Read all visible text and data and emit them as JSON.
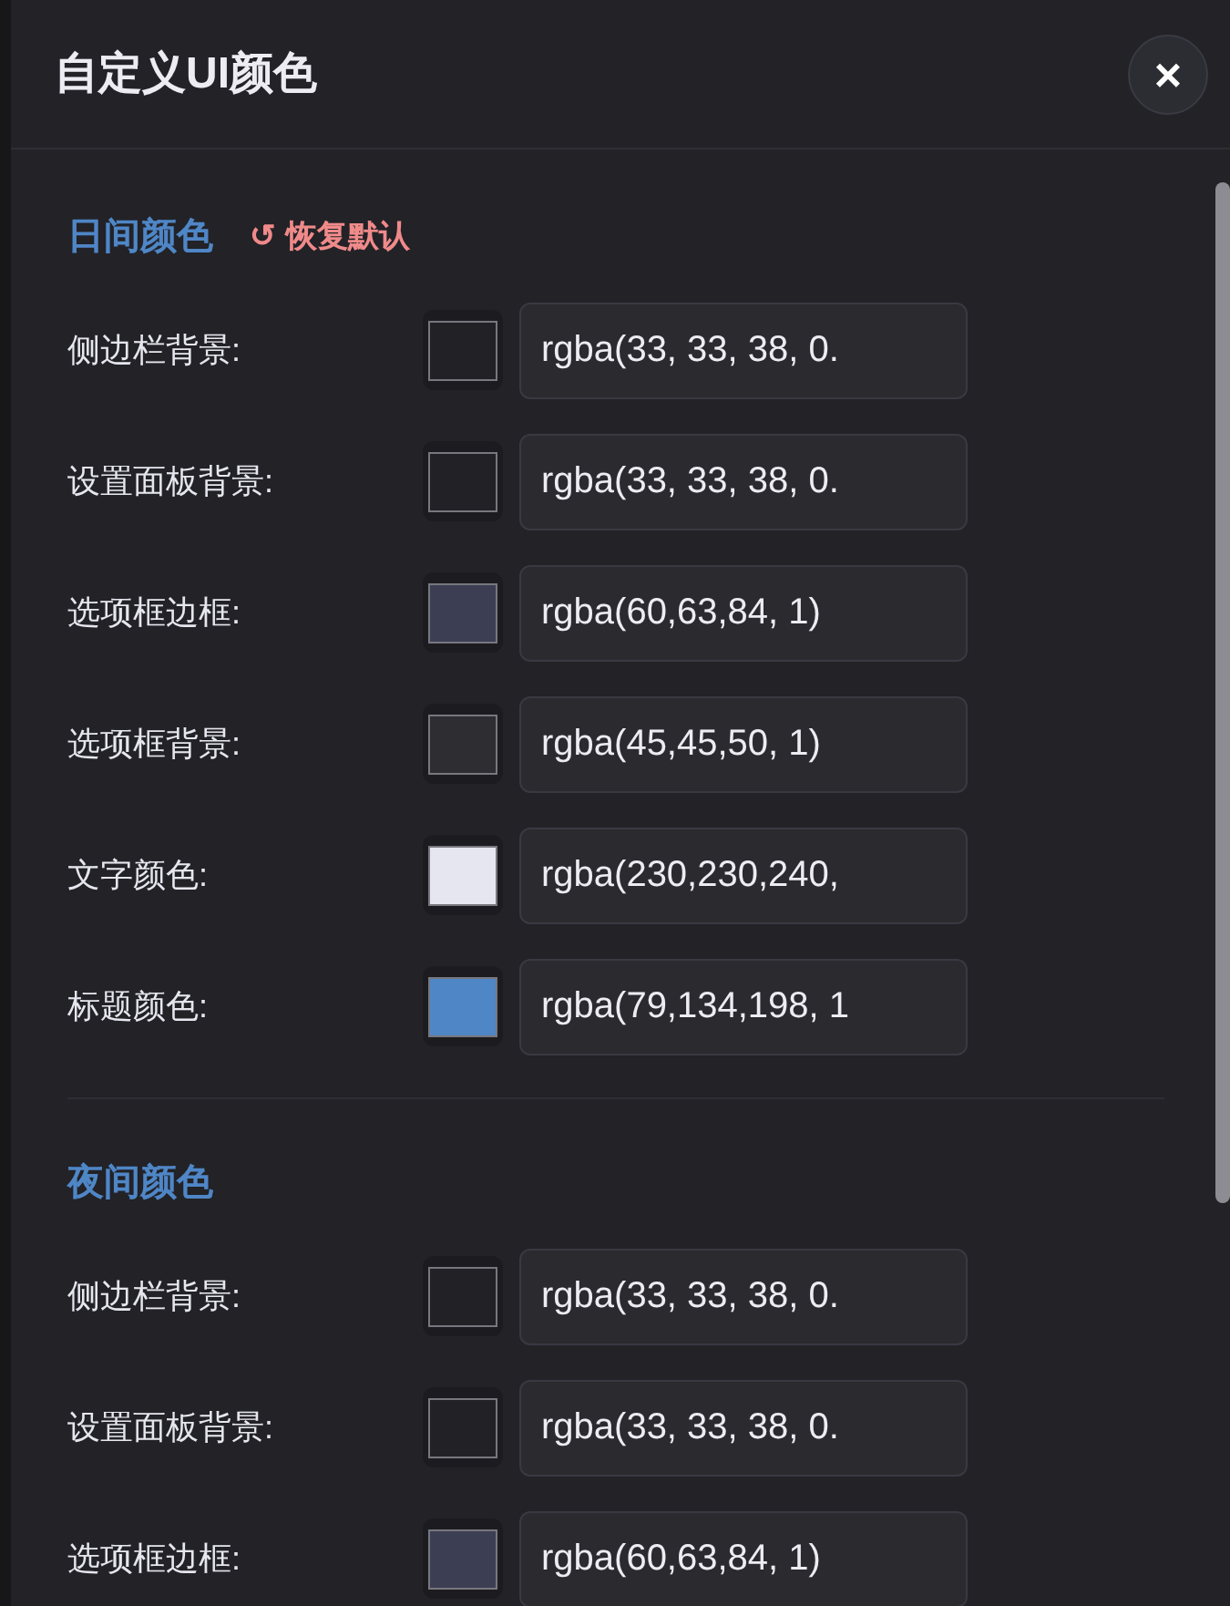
{
  "dialog": {
    "title": "自定义UI颜色",
    "close": "×"
  },
  "sections": [
    {
      "title": "日间颜色",
      "reset": {
        "icon": "↺",
        "label": "恢复默认"
      },
      "rows": [
        {
          "label": "侧边栏背景:",
          "color": "#212126",
          "value": "rgba(33, 33, 38, 0."
        },
        {
          "label": "设置面板背景:",
          "color": "#212126",
          "value": "rgba(33, 33, 38, 0."
        },
        {
          "label": "选项框边框:",
          "color": "#3c3f54",
          "value": "rgba(60,63,84, 1)"
        },
        {
          "label": "选项框背景:",
          "color": "#2d2d32",
          "value": "rgba(45,45,50, 1)"
        },
        {
          "label": "文字颜色:",
          "color": "#e6e6f0",
          "value": "rgba(230,230,240,"
        },
        {
          "label": "标题颜色:",
          "color": "#4f86c6",
          "value": "rgba(79,134,198, 1"
        }
      ]
    },
    {
      "title": "夜间颜色",
      "rows": [
        {
          "label": "侧边栏背景:",
          "color": "#212126",
          "value": "rgba(33, 33, 38, 0."
        },
        {
          "label": "设置面板背景:",
          "color": "#212126",
          "value": "rgba(33, 33, 38, 0."
        },
        {
          "label": "选项框边框:",
          "color": "#3c3f54",
          "value": "rgba(60,63,84, 1)"
        }
      ]
    }
  ]
}
